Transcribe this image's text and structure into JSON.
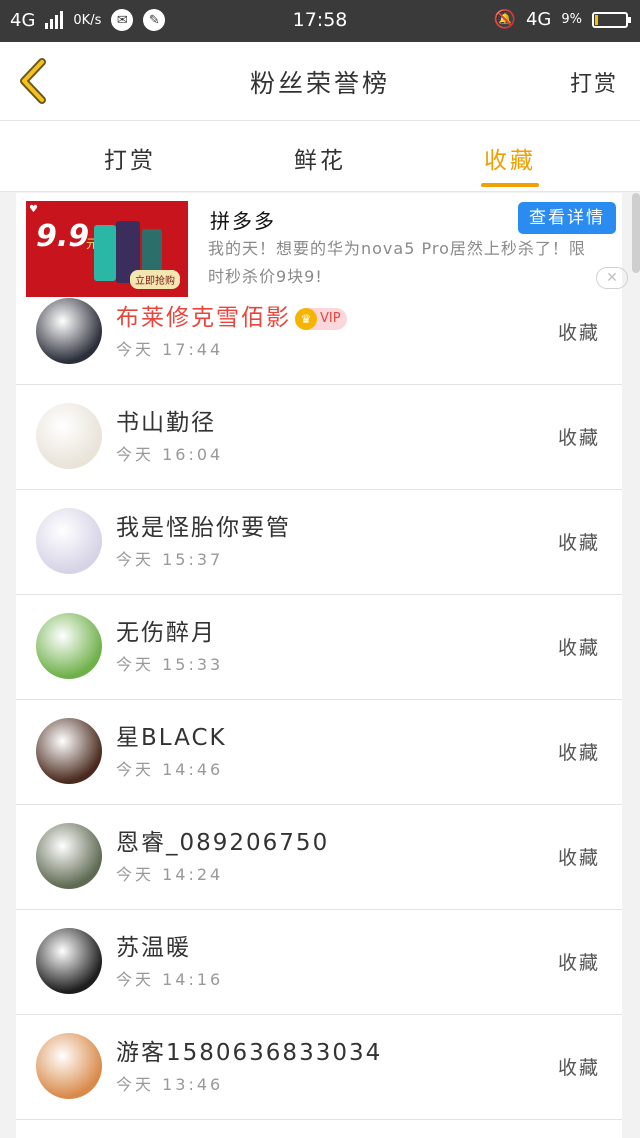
{
  "status_bar": {
    "network": "4G",
    "speed": "0K/s",
    "time": "17:58",
    "network_right": "4G",
    "battery": "9%",
    "battery_level": 0.09
  },
  "header": {
    "title": "粉丝荣誉榜",
    "action": "打赏",
    "back_icon": "chevron-left-icon"
  },
  "tabs": [
    {
      "label": "打赏",
      "active": false
    },
    {
      "label": "鲜花",
      "active": false
    },
    {
      "label": "收藏",
      "active": true
    }
  ],
  "ad": {
    "title": "拼多多",
    "button": "查看详情",
    "description": "我的天！想要的华为nova5 Pro居然上秒杀了！限时秒杀价9块9!",
    "image_price": "9.9",
    "image_unit": "元",
    "image_button": "立即抢购",
    "close_icon": "close-icon"
  },
  "rows": [
    {
      "name": "布莱修克雪佰影",
      "time": "今天 17:44",
      "action": "收藏",
      "vip": true,
      "vip_label": "VIP",
      "avatar_color": "#2b2f3a"
    },
    {
      "name": "书山勤径",
      "time": "今天 16:04",
      "action": "收藏",
      "vip": false,
      "avatar_color": "#e9e3d8"
    },
    {
      "name": "我是怪胎你要管",
      "time": "今天 15:37",
      "action": "收藏",
      "vip": false,
      "avatar_color": "#d6d3e6"
    },
    {
      "name": "无伤醉月",
      "time": "今天 15:33",
      "action": "收藏",
      "vip": false,
      "avatar_color": "#6fb04a"
    },
    {
      "name": "星BLACK",
      "time": "今天 14:46",
      "action": "收藏",
      "vip": false,
      "avatar_color": "#4a2a1e"
    },
    {
      "name": "恩睿_089206750",
      "time": "今天 14:24",
      "action": "收藏",
      "vip": false,
      "avatar_color": "#5e6a52"
    },
    {
      "name": "苏温暖",
      "time": "今天 14:16",
      "action": "收藏",
      "vip": false,
      "avatar_color": "#1e1e1e"
    },
    {
      "name": "游客1580636833034",
      "time": "今天 13:46",
      "action": "收藏",
      "vip": false,
      "avatar_color": "#d98a4a"
    }
  ],
  "colors": {
    "accent": "#f0a000",
    "vip_name": "#e8453c",
    "ad_button": "#2a8cf0"
  }
}
